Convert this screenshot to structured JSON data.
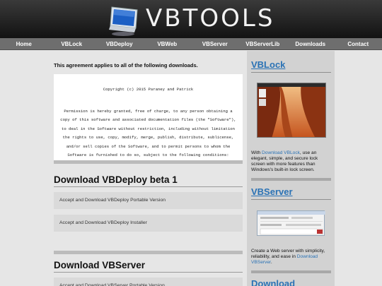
{
  "header": {
    "logo_text": "VBTOOLS"
  },
  "nav": {
    "items": [
      {
        "label": "Home"
      },
      {
        "label": "VBLock"
      },
      {
        "label": "VBDeploy"
      },
      {
        "label": "VBWeb"
      },
      {
        "label": "VBServer"
      },
      {
        "label": "VBServerLib"
      },
      {
        "label": "Downloads"
      },
      {
        "label": "Contact"
      }
    ]
  },
  "main": {
    "intro": "This agreement applies to all of the following downloads.",
    "license": {
      "copyright": "Copyright (c) 2015 Paraney and Patrick",
      "permission": "Permission is hereby granted, free of charge, to any person obtaining a copy of this software and associated documentation files (the \"Software\"), to deal in the Software without restriction, including without limitation the rights to use, copy, modify, merge, publish, distribute, sublicense, and/or sell copies of the Software, and to permit persons to whom the Software is furnished to do so, subject to the following conditions:"
    },
    "sections": [
      {
        "title": "Download VBDeploy beta 1",
        "buttons": [
          "Accept and Download VBDeploy Portable Version",
          "Accept and Download VBDeploy Installer"
        ]
      },
      {
        "title": "Download VBServer",
        "buttons": [
          "Accept and Download VBServer Portable Version"
        ]
      }
    ]
  },
  "sidebar": {
    "vblock": {
      "title": "VBLock",
      "text_pre": "With ",
      "link": "Download VBLock",
      "text_post": ", use an elegant, simple, and secure lock screen with more features than Windows's built-in lock screen."
    },
    "vbserver": {
      "title": "VBServer",
      "text_pre": "Create a Web server with simplicity, reliability, and ease in ",
      "link": "Download VBServer",
      "text_post": "."
    },
    "next_title": "Download"
  }
}
